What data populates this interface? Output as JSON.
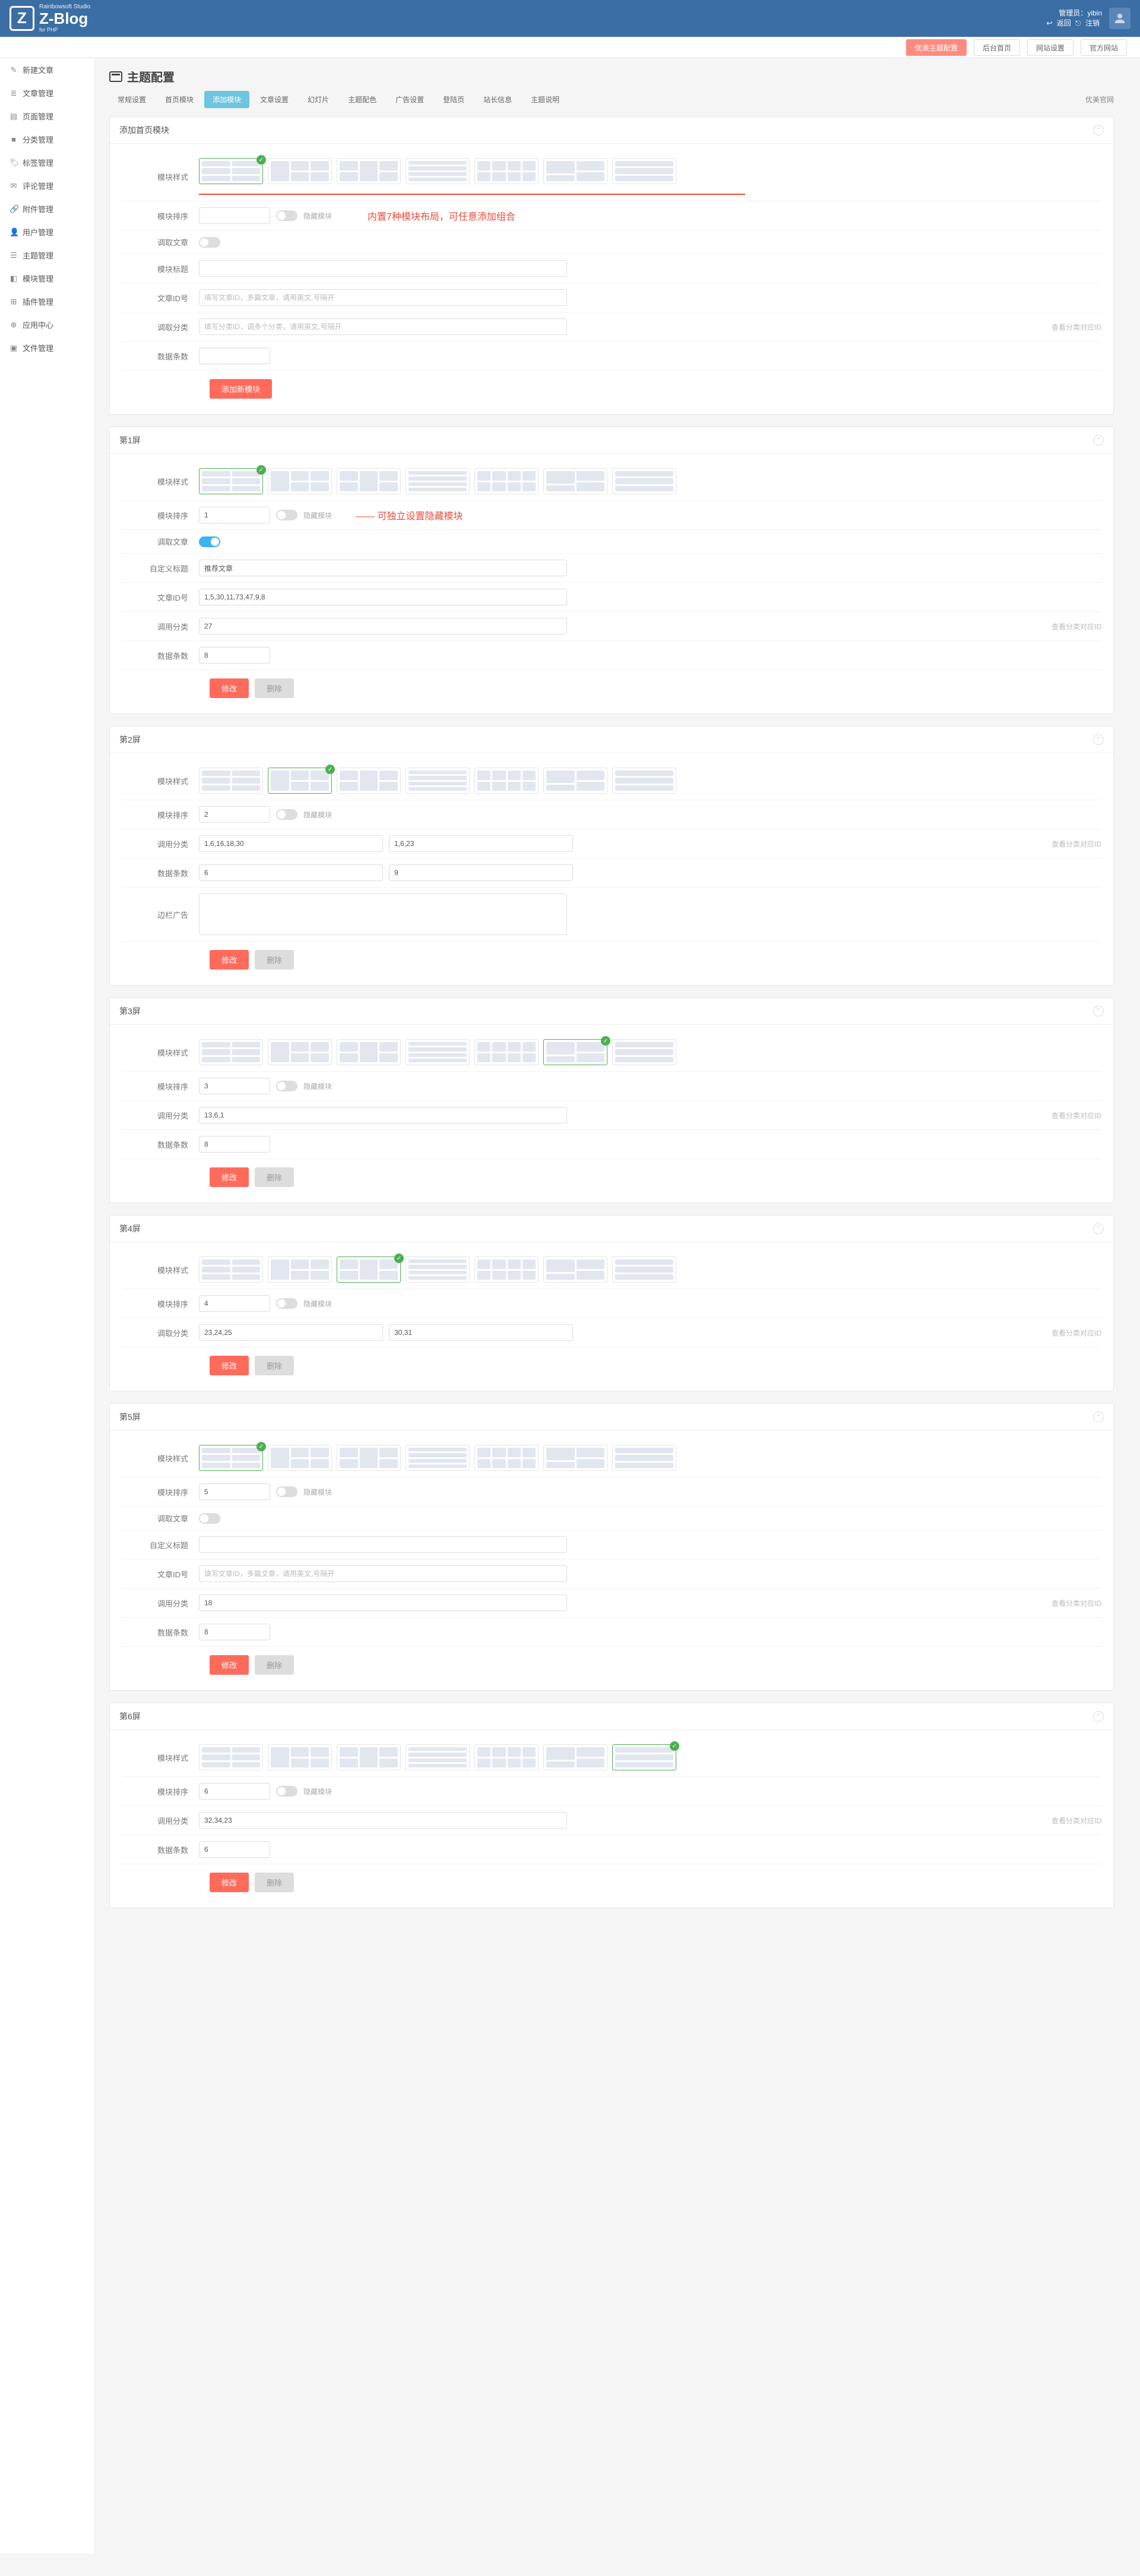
{
  "header": {
    "logo_line1": "Rainbowsoft Studio",
    "logo_line2": "Z-Blog",
    "logo_line3": "for PHP",
    "admin_label": "管理员：",
    "admin_name": "yibin",
    "back": "返回",
    "logout": "注销"
  },
  "topnav": [
    {
      "label": "优美主题配置",
      "active": true
    },
    {
      "label": "后台首页"
    },
    {
      "label": "网站设置"
    },
    {
      "label": "官方网站"
    }
  ],
  "sidebar": [
    {
      "icon": "✎",
      "label": "新建文章"
    },
    {
      "icon": "≣",
      "label": "文章管理"
    },
    {
      "icon": "▤",
      "label": "页面管理"
    },
    {
      "icon": "■",
      "label": "分类管理"
    },
    {
      "icon": "🏷",
      "label": "标签管理"
    },
    {
      "icon": "✉",
      "label": "评论管理"
    },
    {
      "icon": "🔗",
      "label": "附件管理"
    },
    {
      "icon": "👤",
      "label": "用户管理"
    },
    {
      "icon": "☰",
      "label": "主题管理"
    },
    {
      "icon": "◧",
      "label": "模块管理"
    },
    {
      "icon": "⊞",
      "label": "插件管理"
    },
    {
      "icon": "⊕",
      "label": "应用中心"
    },
    {
      "icon": "▣",
      "label": "文件管理"
    }
  ],
  "page_title": "主题配置",
  "tabs": [
    "常规设置",
    "首页模块",
    "添加模块",
    "文章设置",
    "幻灯片",
    "主题配色",
    "广告设置",
    "登陆页",
    "站长信息",
    "主题说明"
  ],
  "tabs_active": 2,
  "tabs_right": "优美官网",
  "labels": {
    "style": "模块样式",
    "sort": "模块排序",
    "hide": "隐藏模块",
    "transfer": "调取文章",
    "title": "模块标题",
    "custom_title": "自定义标题",
    "article_id": "文章ID号",
    "call_cat": "调用分类",
    "get_cat": "调取分类",
    "count": "数据条数",
    "side_ad": "边栏广告",
    "cat_hint": "查看分类对应ID",
    "add_btn": "添加新模块",
    "modify": "修改",
    "delete": "删除"
  },
  "placeholders": {
    "article_id": "填写文章ID，多篇文章，请用英文,号隔开",
    "cat": "填写分类ID，调多个分类，请用英文,号隔开"
  },
  "annot": {
    "layouts": "内置7种模块布局，可任意添加组合",
    "hide": "—— 可独立设置隐藏模块"
  },
  "panels": {
    "add": {
      "title": "添加首页模块",
      "sort": "",
      "title_val": "",
      "article_id": "",
      "cat": "",
      "count": "",
      "sel": 0,
      "transfer": false
    },
    "s1": {
      "title": "第1屏",
      "sort": "1",
      "custom_title": "推荐文章",
      "article_id": "1,5,30,11,73,47,9,8",
      "cat": "27",
      "count": "8",
      "sel": 0,
      "transfer": true
    },
    "s2": {
      "title": "第2屏",
      "sort": "2",
      "cat1": "1,6,16,18,30",
      "cat2": "1,6,23",
      "count1": "6",
      "count2": "9",
      "sidead": "",
      "sel": 1
    },
    "s3": {
      "title": "第3屏",
      "sort": "3",
      "cat": "13,6,1",
      "count": "8",
      "sel": 5
    },
    "s4": {
      "title": "第4屏",
      "sort": "4",
      "cat1": "23,24,25",
      "cat2": "30,31",
      "sel": 2
    },
    "s5": {
      "title": "第5屏",
      "sort": "5",
      "custom_title": "",
      "article_id": "",
      "cat": "18",
      "count": "8",
      "sel": 0,
      "transfer": false
    },
    "s6": {
      "title": "第6屏",
      "sort": "6",
      "cat": "32,34,23",
      "count": "6",
      "sel": 6
    }
  }
}
